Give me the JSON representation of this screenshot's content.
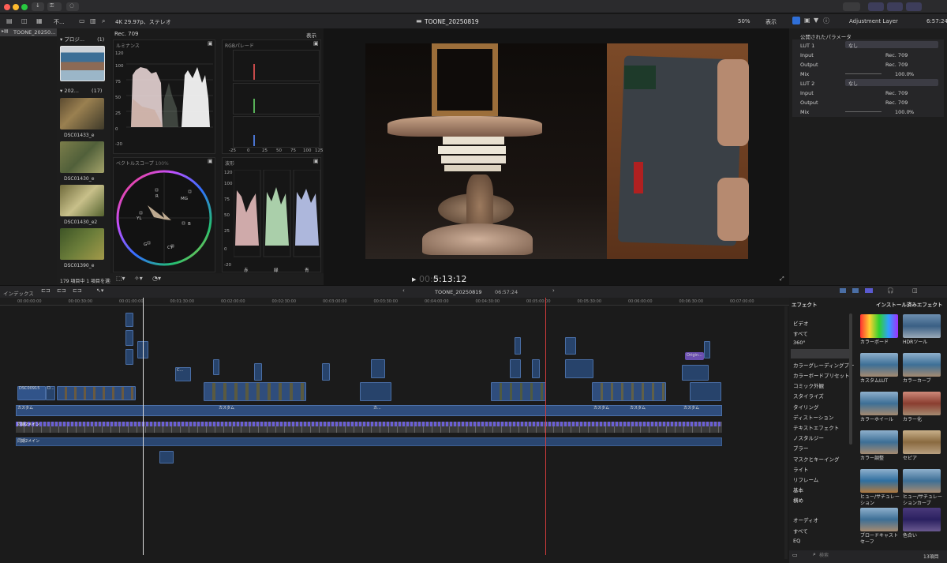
{
  "app": {
    "format": "4K 29.97p、ステレオ",
    "project_title": "TOONE_20250819",
    "zoom": "50%",
    "view_label": "表示",
    "inspector_title": "Adjustment Layer",
    "inspector_time": "6:57:24",
    "library_filter": "不...",
    "library_name": "TOONE_20250..."
  },
  "browser": {
    "group1": {
      "label": "プロジ...",
      "count": "(1)"
    },
    "group2": {
      "label": "202...",
      "count": "(17)"
    },
    "clips": [
      "DSC01433_e",
      "DSC01430_e",
      "DSC01430_e2",
      "DSC01390_e"
    ],
    "status": "179 項目中 1 項目を選択"
  },
  "scopes": {
    "color_space": "Rec. 709",
    "view_label": "表示",
    "luminance_title": "ルミナンス",
    "luminance_ticks": [
      "120",
      "100",
      "75",
      "50",
      "25",
      "0",
      "-20"
    ],
    "rgb_title": "RGBパレード",
    "rgb_ticks": [
      "-25",
      "0",
      "25",
      "50",
      "75",
      "100",
      "125"
    ],
    "vector_title": "ベクトルスコープ",
    "vector_pct": "100%",
    "vector_labels": [
      "R",
      "MG",
      "YL",
      "B",
      "G",
      "CY"
    ],
    "wave_title": "波形",
    "wave_ticks": [
      "120",
      "100",
      "75",
      "50",
      "25",
      "0",
      "-20"
    ],
    "wave_channels": [
      "赤",
      "緑",
      "青"
    ]
  },
  "viewer": {
    "timecode_dim": "00:0",
    "timecode": "5:13:12"
  },
  "inspector": {
    "section_title": "公開されたパラメータ",
    "lut1": {
      "label": "LUT 1",
      "value": "なし",
      "input": "Rec. 709",
      "output": "Rec. 709",
      "mix": "100.0"
    },
    "lut2": {
      "label": "LUT 2",
      "value": "なし",
      "input": "Rec. 709",
      "output": "Rec. 709",
      "mix": "100.0"
    },
    "input_label": "Input",
    "output_label": "Output",
    "mix_label": "Mix",
    "pct": "%"
  },
  "timeline": {
    "index_label": "インデックス",
    "project": "TOONE_20250819",
    "duration": "06:57:24",
    "ruler": [
      "00:00:00:00",
      "00:00:30:00",
      "00:01:00:00",
      "00:01:30:00",
      "00:02:00:00",
      "00:02:30:00",
      "00:03:00:00",
      "00:03:30:00",
      "00:04:00:00",
      "00:04:30:00",
      "00:05:00:00",
      "00:05:30:00",
      "00:06:00:00",
      "00:06:30:00",
      "00:07:00:00"
    ],
    "clip_labels": {
      "dsc": "DSC00915",
      "custom": "カスタム",
      "custom2": "カスタム",
      "custom3": "カスタム",
      "custom4": "カスタム",
      "custom5": "カスタム",
      "origin": "Origin...",
      "audio1": "同期2メイン",
      "audio2": "同期2メイン",
      "c": "C...",
      "d": "D...",
      "ka": "カ..."
    }
  },
  "effects": {
    "title": "エフェクト",
    "installed": "インストール済みエフェクト",
    "categories": [
      "ビデオ",
      "すべて",
      "360°",
      "カラー",
      "カラーグレーディングプー",
      "カラーボードプリセット",
      "コミック外観",
      "スタイライズ",
      "タイリング",
      "ディストーション",
      "テキストエフェクト",
      "ノスタルジー",
      "ブラー",
      "マスクとキーイング",
      "ライト",
      "リフレーム",
      "基本",
      "横め"
    ],
    "audio_title": "オーディオ",
    "audio_all": "すべて",
    "audio_eq": "EQ",
    "items": [
      "カラーボード",
      "HDRツール",
      "カスタムLUT",
      "カラーカーブ",
      "カラーホイール",
      "カラー化",
      "カラー調整",
      "セピア",
      "ヒュー/サチュレーション",
      "ヒュー/サチュレーションカーブ",
      "ブロードキャストセーフ",
      "色合い"
    ],
    "search_placeholder": "検索",
    "count": "13項目"
  },
  "colors": {
    "accent": "#2f6fd8",
    "playhead": "#d23c3c",
    "clip_blue": "#2f4d7c",
    "audio_purple": "#6b5fd6"
  }
}
